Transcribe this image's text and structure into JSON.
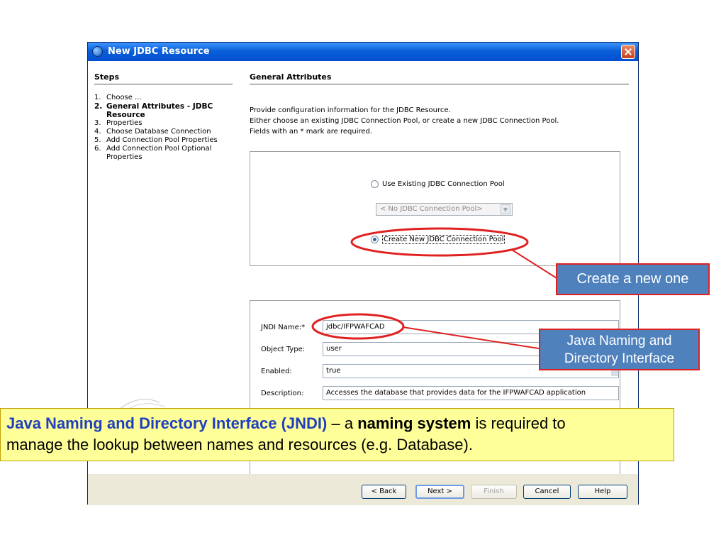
{
  "window": {
    "title": "New JDBC Resource"
  },
  "steps": {
    "heading": "Steps",
    "items": [
      {
        "num": "1.",
        "label": "Choose ...",
        "current": false
      },
      {
        "num": "2.",
        "label": "General Attributes - JDBC Resource",
        "current": true
      },
      {
        "num": "3.",
        "label": "Properties",
        "current": false
      },
      {
        "num": "4.",
        "label": "Choose Database Connection",
        "current": false
      },
      {
        "num": "5.",
        "label": "Add Connection Pool Properties",
        "current": false
      },
      {
        "num": "6.",
        "label": "Add Connection Pool Optional Properties",
        "current": false
      }
    ]
  },
  "general": {
    "heading": "General Attributes",
    "desc_line1": "Provide configuration information for the JDBC Resource.",
    "desc_line2": "Either choose an existing JDBC Connection Pool, or create a new JDBC Connection Pool.",
    "desc_line3": "Fields with an * mark are required.",
    "radio_existing": "Use Existing JDBC Connection Pool",
    "radio_existing_selected": false,
    "pool_select_value": "< No JDBC Connection Pool>",
    "radio_new": "Create New JDBC Connection Pool",
    "radio_new_selected": true
  },
  "fields": {
    "jndi_label": "JNDI Name:*",
    "jndi_value": "jdbc/IFPWAFCAD",
    "type_label": "Object Type:",
    "type_value": "user",
    "enabled_label": "Enabled:",
    "enabled_value": "true",
    "desc_label": "Description:",
    "desc_value": "Accesses the database that provides data for the IFPWAFCAD application"
  },
  "buttons": {
    "back": "< Back",
    "next": "Next >",
    "finish": "Finish",
    "cancel": "Cancel",
    "help": "Help"
  },
  "annotations": {
    "callout_new": "Create a new one",
    "callout_jndi_line1": "Java Naming and",
    "callout_jndi_line2": "Directory Interface",
    "info_term": "Java Naming and Directory Interface (JNDI)",
    "info_dash": " – a ",
    "info_bold": "naming system",
    "info_rest1": " is required to",
    "info_rest2": "manage the lookup between names and resources (e.g. Database)."
  },
  "colors": {
    "callout_fill": "#4f81bd",
    "callout_border": "#e02020",
    "info_fill": "#ffff99",
    "info_term": "#1f3fbf",
    "titlebar": "#0a5fd9"
  },
  "icons": [
    "app-icon",
    "close-icon",
    "chevron-down-icon"
  ]
}
